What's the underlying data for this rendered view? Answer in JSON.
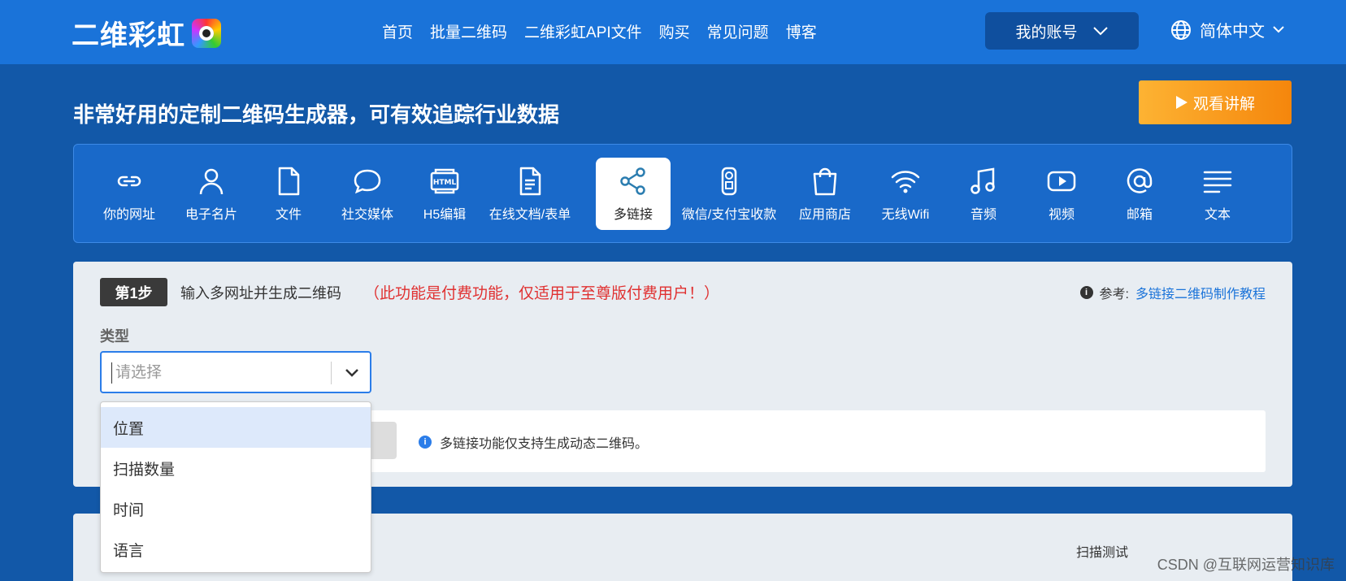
{
  "header": {
    "logo_text": "二维彩虹",
    "nav": [
      "首页",
      "批量二维码",
      "二维彩虹API文件",
      "购买",
      "常见问题",
      "博客"
    ],
    "account_label": "我的账号",
    "language_label": "简体中文"
  },
  "hero": {
    "tagline": "非常好用的定制二维码生成器，可有效追踪行业数据",
    "video_label": "观看讲解"
  },
  "categories": [
    {
      "label": "你的网址",
      "icon": "link-icon"
    },
    {
      "label": "电子名片",
      "icon": "person-icon"
    },
    {
      "label": "文件",
      "icon": "file-icon"
    },
    {
      "label": "社交媒体",
      "icon": "chat-icon"
    },
    {
      "label": "H5编辑",
      "icon": "html-icon"
    },
    {
      "label": "在线文档/表单",
      "icon": "document-icon"
    },
    {
      "label": "多链接",
      "icon": "share-icon",
      "active": true
    },
    {
      "label": "微信/支付宝收款",
      "icon": "payment-icon"
    },
    {
      "label": "应用商店",
      "icon": "bag-icon"
    },
    {
      "label": "无线Wifi",
      "icon": "wifi-icon"
    },
    {
      "label": "音频",
      "icon": "music-icon"
    },
    {
      "label": "视频",
      "icon": "video-icon"
    },
    {
      "label": "邮箱",
      "icon": "at-icon"
    },
    {
      "label": "文本",
      "icon": "text-lines-icon"
    }
  ],
  "step": {
    "badge": "第1步",
    "title": "输入多网址并生成二维码",
    "warning": "（此功能是付费功能，仅适用于至尊版付费用户！）",
    "ref_label": "参考:",
    "ref_link": "多链接二维码制作教程",
    "type_label": "类型",
    "select_placeholder": "请选择",
    "info": "多链接功能仅支持生成动态二维码。"
  },
  "dropdown": {
    "options": [
      "位置",
      "扫描数量",
      "时间",
      "语言"
    ],
    "highlighted": "位置"
  },
  "panel2": {
    "scan_test": "扫描测试"
  },
  "watermark": "CSDN @互联网运营知识库",
  "colors": {
    "nav_bg": "#1a73d9",
    "page_bg": "#1258a8",
    "warning": "#e03131",
    "accent_orange": "#f5860c"
  }
}
